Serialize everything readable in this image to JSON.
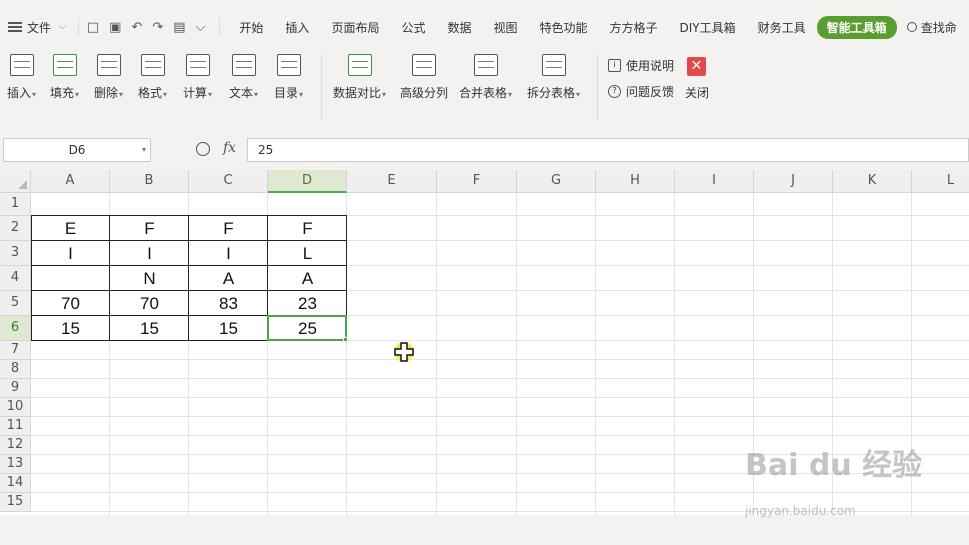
{
  "menubar": {
    "file_label": "文件",
    "tabs": [
      "开始",
      "插入",
      "页面布局",
      "公式",
      "数据",
      "视图",
      "特色功能",
      "方方格子",
      "DIY工具箱",
      "财务工具",
      "智能工具箱"
    ],
    "active_tab": "智能工具箱",
    "search_label": "查找命"
  },
  "ribbon": {
    "buttons": [
      {
        "label": "插入",
        "icon": "insert-icon"
      },
      {
        "label": "填充",
        "icon": "fill-icon"
      },
      {
        "label": "删除",
        "icon": "delete-icon"
      },
      {
        "label": "格式",
        "icon": "format-icon"
      },
      {
        "label": "计算",
        "icon": "calculate-icon"
      },
      {
        "label": "文本",
        "icon": "text-icon"
      },
      {
        "label": "目录",
        "icon": "catalog-icon"
      },
      {
        "label": "数据对比",
        "icon": "data-compare-icon"
      },
      {
        "label": "高级分列",
        "icon": "split-columns-icon"
      },
      {
        "label": "合并表格",
        "icon": "merge-tables-icon"
      },
      {
        "label": "拆分表格",
        "icon": "split-table-icon"
      }
    ],
    "help_label": "使用说明",
    "feedback_label": "问题反馈",
    "close_label": "关闭"
  },
  "formula_bar": {
    "name_box": "D6",
    "fx_label": "fx",
    "formula": "25"
  },
  "sheet": {
    "columns": [
      "A",
      "B",
      "C",
      "D",
      "E",
      "F",
      "G",
      "H",
      "I",
      "J",
      "K",
      "L"
    ],
    "selected_column": "D",
    "rows": [
      "1",
      "2",
      "3",
      "4",
      "5",
      "6",
      "7",
      "8",
      "9",
      "10",
      "11",
      "12",
      "13",
      "14",
      "15"
    ],
    "selected_row": "6",
    "cells": [
      [
        "",
        "",
        "",
        ""
      ],
      [
        "E",
        "F",
        "F",
        "F"
      ],
      [
        "I",
        "I",
        "I",
        "L"
      ],
      [
        "",
        "N",
        "A",
        "A"
      ],
      [
        "70",
        "70",
        "83",
        "23"
      ],
      [
        "15",
        "15",
        "15",
        "25"
      ]
    ]
  },
  "watermark": {
    "brand": "Bai du 经验",
    "url": "jingyan.baidu.com"
  }
}
